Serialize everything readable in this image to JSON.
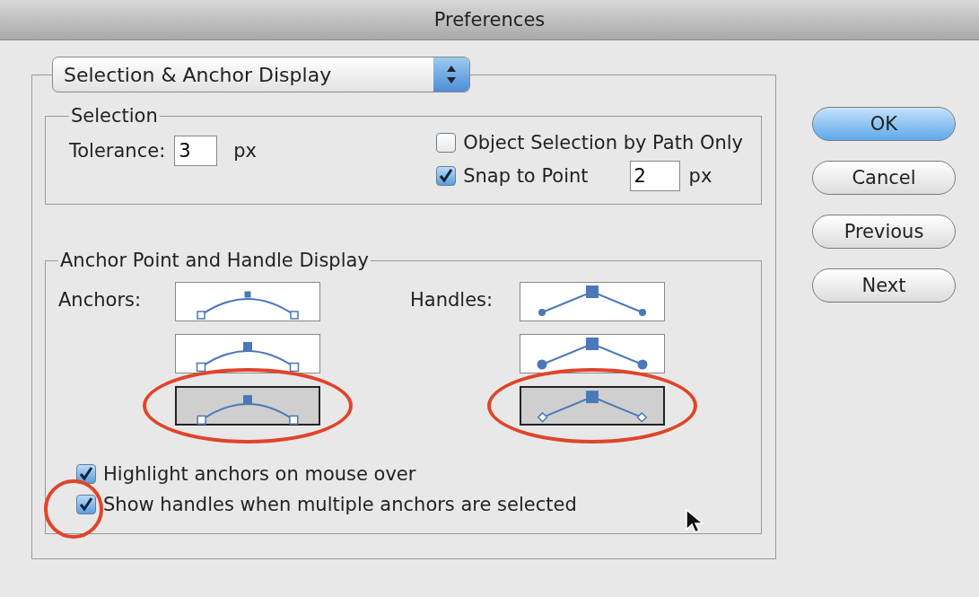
{
  "window": {
    "title": "Preferences"
  },
  "category": {
    "value": "Selection & Anchor Display"
  },
  "selection": {
    "title": "Selection",
    "tolerance": {
      "label": "Tolerance:",
      "value": "3",
      "unit": "px"
    },
    "object_by_path": {
      "label": "Object Selection by Path Only",
      "checked": false
    },
    "snap": {
      "label": "Snap to Point",
      "checked": true,
      "value": "2",
      "unit": "px"
    }
  },
  "anchor_display": {
    "title": "Anchor Point and Handle Display",
    "anchors_label": "Anchors:",
    "handles_label": "Handles:",
    "anchors": [
      {
        "kind": "small",
        "selected": false,
        "circled": false
      },
      {
        "kind": "medium",
        "selected": false,
        "circled": false
      },
      {
        "kind": "large",
        "selected": true,
        "circled": true
      }
    ],
    "handles": [
      {
        "kind": "dot",
        "selected": false,
        "circled": false
      },
      {
        "kind": "large-dot",
        "selected": false,
        "circled": false
      },
      {
        "kind": "diamond",
        "selected": true,
        "circled": true
      }
    ],
    "options": [
      {
        "label": "Highlight anchors on mouse over",
        "checked": true,
        "circled": false
      },
      {
        "label": "Show handles when multiple anchors are selected",
        "checked": true,
        "circled": true
      }
    ]
  },
  "buttons": [
    {
      "label": "OK",
      "default": true
    },
    {
      "label": "Cancel",
      "default": false
    },
    {
      "label": "Previous",
      "default": false
    },
    {
      "label": "Next",
      "default": false
    }
  ]
}
